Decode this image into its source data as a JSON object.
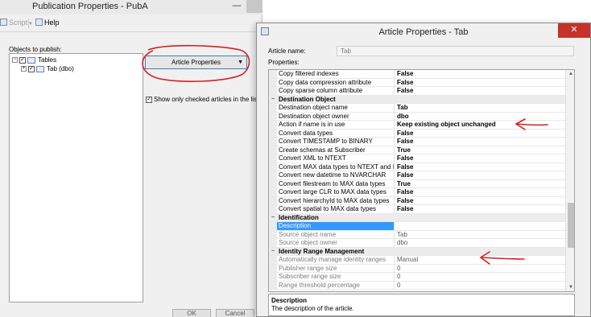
{
  "pub_window": {
    "title": "Publication Properties - PubA",
    "minimize_glyph": "—",
    "toolbar": {
      "script_label": "Script",
      "help_label": "Help"
    },
    "objects_label": "Objects to publish:",
    "tree": [
      {
        "label": "Tables",
        "expand": "−",
        "checked": "✓"
      },
      {
        "label": "Tab (dbo)",
        "expand": "+",
        "checked": "✓"
      }
    ],
    "article_properties_button": "Article Properties",
    "show_only_checked_label": "Show only checked articles in the list",
    "bottom_buttons": [
      "OK",
      "Cancel"
    ]
  },
  "art_window": {
    "title": "Article Properties - Tab",
    "close_glyph": "✕",
    "article_name_label": "Article name:",
    "article_name_value": "Tab",
    "properties_label": "Properties:",
    "rows": [
      {
        "name": "Copy filtered indexes",
        "value": "False"
      },
      {
        "name": "Copy data compression attribute",
        "value": "False"
      },
      {
        "name": "Copy sparse column attribute",
        "value": "False"
      },
      {
        "name": "Destination Object",
        "category": true,
        "toggle": "−"
      },
      {
        "name": "Destination object name",
        "value": "Tab"
      },
      {
        "name": "Destination object owner",
        "value": "dbo"
      },
      {
        "name": "Action if name is in use",
        "value": "Keep existing object unchanged"
      },
      {
        "name": "Convert data types",
        "value": "False"
      },
      {
        "name": "Convert TIMESTAMP to BINARY",
        "value": "False"
      },
      {
        "name": "Create schemas at Subscriber",
        "value": "True"
      },
      {
        "name": "Convert XML to NTEXT",
        "value": "False"
      },
      {
        "name": "Convert MAX data types to NTEXT and IMAGE",
        "value": "False"
      },
      {
        "name": "Convert new datetime to NVARCHAR",
        "value": "False"
      },
      {
        "name": "Convert filestream to MAX data types",
        "value": "True"
      },
      {
        "name": "Convert large CLR to MAX data types",
        "value": "False"
      },
      {
        "name": "Convert hierarchyId to MAX data types",
        "value": "False"
      },
      {
        "name": "Convert spatial to MAX data types",
        "value": "False"
      },
      {
        "name": "Identification",
        "category": true,
        "toggle": "−"
      },
      {
        "name": "Description",
        "value": "",
        "selected": true
      },
      {
        "name": "Source object name",
        "value": "Tab",
        "dim": true
      },
      {
        "name": "Source object owner",
        "value": "dbo",
        "dim": true
      },
      {
        "name": "Identity Range Management",
        "category": true,
        "toggle": "−"
      },
      {
        "name": "Automatically manage identity ranges",
        "value": "Manual",
        "dim": true
      },
      {
        "name": "Publisher range size",
        "value": "0",
        "dim": true
      },
      {
        "name": "Subscriber range size",
        "value": "0",
        "dim": true
      },
      {
        "name": "Range threshold percentage",
        "value": "0",
        "dim": true
      }
    ],
    "description_title": "Description",
    "description_text": "The description of the article."
  },
  "colors": {
    "annotation_red": "#d42020",
    "selection_blue": "#3399ff",
    "close_red": "#c7312b"
  }
}
